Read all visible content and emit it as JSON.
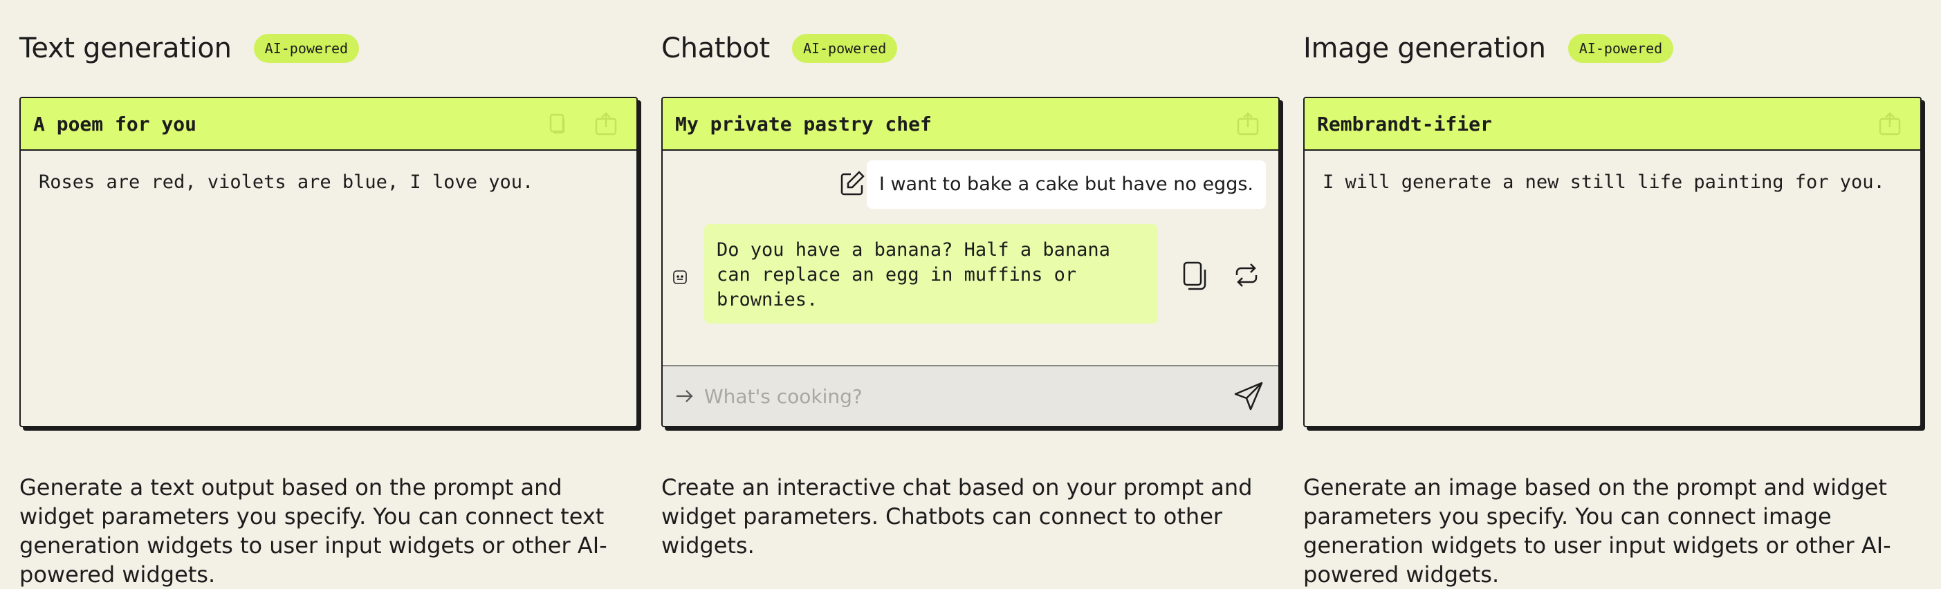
{
  "columns": [
    {
      "title": "Text generation",
      "badge": "AI-powered",
      "card_title": "A poem for you",
      "card_text": "Roses are red, violets are blue, I love you.",
      "description": "Generate a text output based on the prompt and widget parameters you specify. You can connect text generation widgets to user input widgets or other AI-powered widgets.",
      "header_icons": [
        "copy-icon",
        "share-icon"
      ]
    },
    {
      "title": "Chatbot",
      "badge": "AI-powered",
      "card_title": "My private pastry chef",
      "user_message": "I want to bake a cake but have no eggs.",
      "bot_message": "Do you have a banana? Half a banana can replace an egg in muffins or brownies.",
      "input_placeholder": "What's cooking?",
      "description": "Create an interactive chat based on your prompt and widget parameters. Chatbots can connect to other widgets.",
      "header_icons": [
        "share-icon"
      ]
    },
    {
      "title": "Image generation",
      "badge": "AI-powered",
      "card_title": "Rembrandt-ifier",
      "card_text": "I will generate a new still life painting for you.",
      "description": "Generate an image based on the prompt and widget parameters you specify. You can connect image generation widgets to user input widgets or other AI-powered widgets.",
      "header_icons": [
        "share-icon"
      ]
    }
  ],
  "colors": {
    "background": "#f3f0e6",
    "accent": "#dbfb72",
    "badge": "#cff25a",
    "bot_bubble": "#e8fcaa"
  }
}
